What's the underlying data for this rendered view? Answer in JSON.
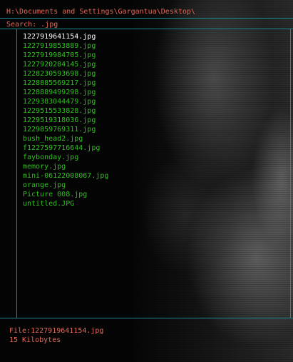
{
  "path": "H:\\Documents and Settings\\Gargantua\\Desktop\\",
  "search": {
    "label": "Search: ",
    "value": ".jpg"
  },
  "files": [
    "1227919641154.jpg",
    "1227919853889.jpg",
    "1227919984705.jpg",
    "1227920284145.jpg",
    "1228230593698.jpg",
    "1228885569217.jpg",
    "1228889499298.jpg",
    "1229383044479.jpg",
    "1229515533828.jpg",
    "1229519318036.jpg",
    "1229859769311.jpg",
    "bush_head2.jpg",
    "f1227597716644.jpg",
    "faybonday.jpg",
    "memory.jpg",
    "mini-06122008067.jpg",
    "orange.jpg",
    "Picture 008.jpg",
    "untitled.JPG"
  ],
  "selected_index": 0,
  "status": {
    "file": "File:1227919641154.jpg",
    "size": "15 Kilobytes"
  },
  "colors": {
    "label": "#e06a5c",
    "file": "#2fbf1f",
    "selected": "#ffffff",
    "border": "#1c8a93"
  }
}
